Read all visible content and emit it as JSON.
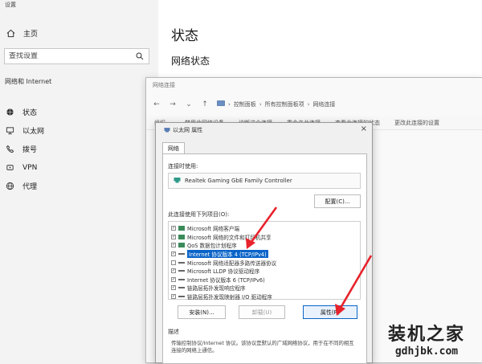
{
  "settings": {
    "window_title": "设置",
    "home_label": "主页",
    "search_placeholder": "查找设置",
    "section_label": "网络和 Internet",
    "nav": [
      {
        "label": "状态",
        "icon": "globe-icon"
      },
      {
        "label": "以太网",
        "icon": "monitor-icon"
      },
      {
        "label": "拨号",
        "icon": "phone-icon"
      },
      {
        "label": "VPN",
        "icon": "vpn-icon"
      },
      {
        "label": "代理",
        "icon": "globe-icon"
      }
    ],
    "main_title": "状态",
    "main_subtitle": "网络状态"
  },
  "network_window": {
    "title": "网络连接",
    "breadcrumb": [
      "控制面板",
      "所有控制面板项",
      "网络连接"
    ],
    "toolbar": [
      "组织",
      "禁用此网络设备",
      "诊断这个连接",
      "重命名此连接",
      "查看此连接的状态",
      "更改此连接的设置"
    ]
  },
  "dialog": {
    "title": "以太网 属性",
    "close": "×",
    "tab": "网络",
    "connect_using_label": "连接时使用:",
    "adapter": "Realtek Gaming GbE Family Controller",
    "configure_button": "配置(C)...",
    "items_label": "此连接使用下列项目(O):",
    "items": [
      {
        "label": "Microsoft 网络客户端",
        "checked": true,
        "selected": false
      },
      {
        "label": "Microsoft 网络的文件和打印机共享",
        "checked": true,
        "selected": false
      },
      {
        "label": "QoS 数据包计划程序",
        "checked": true,
        "selected": false
      },
      {
        "label": "Internet 协议版本 4 (TCP/IPv4)",
        "checked": true,
        "selected": true
      },
      {
        "label": "Microsoft 网络适配器多路传送器协议",
        "checked": false,
        "selected": false
      },
      {
        "label": "Microsoft LLDP 协议驱动程序",
        "checked": true,
        "selected": false
      },
      {
        "label": "Internet 协议版本 6 (TCP/IPv6)",
        "checked": true,
        "selected": false
      },
      {
        "label": "链路层拓扑发现响应程序",
        "checked": true,
        "selected": false
      },
      {
        "label": "链路层拓扑发现映射器 I/O 驱动程序",
        "checked": true,
        "selected": false
      }
    ],
    "install_button": "安装(N)...",
    "uninstall_button": "卸载(U)",
    "properties_button": "属性(R)",
    "description_title": "描述",
    "description_text": "传输控制协议/Internet 协议。该协议是默认的广域网络协议，用于在不同的相互连接的网络上通信。"
  },
  "watermark": {
    "name": "装机之家",
    "url": "gdhjbk.com"
  },
  "colors": {
    "selection": "#0a64c8",
    "arrow": "#e8222a"
  }
}
